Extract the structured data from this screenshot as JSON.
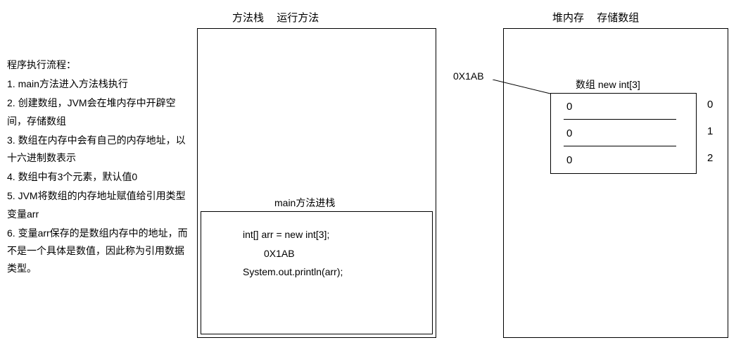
{
  "leftText": {
    "heading": "程序执行流程：",
    "steps": [
      "1. main方法进入方法栈执行",
      "2. 创建数组，JVM会在堆内存中开辟空间，存储数组",
      "3. 数组在内存中会有自己的内存地址，以十六进制数表示",
      "4. 数组中有3个元素，默认值0",
      "5. JVM将数组的内存地址赋值给引用类型变量arr",
      "6. 变量arr保存的是数组内存中的地址，而不是一个具体是数值，因此称为引用数据类型。"
    ]
  },
  "stack": {
    "title1": "方法栈",
    "title2": "运行方法",
    "mainLabel": "main方法进栈",
    "code": {
      "line1": "int[] arr = new int[3];",
      "addr": "0X1AB",
      "line2": "System.out.println(arr);"
    }
  },
  "heap": {
    "title1": "堆内存",
    "title2": "存储数组",
    "addr": "0X1AB",
    "arrayLabel": "数组 new int[3]",
    "cells": [
      "0",
      "0",
      "0"
    ],
    "indices": [
      "0",
      "1",
      "2"
    ]
  }
}
